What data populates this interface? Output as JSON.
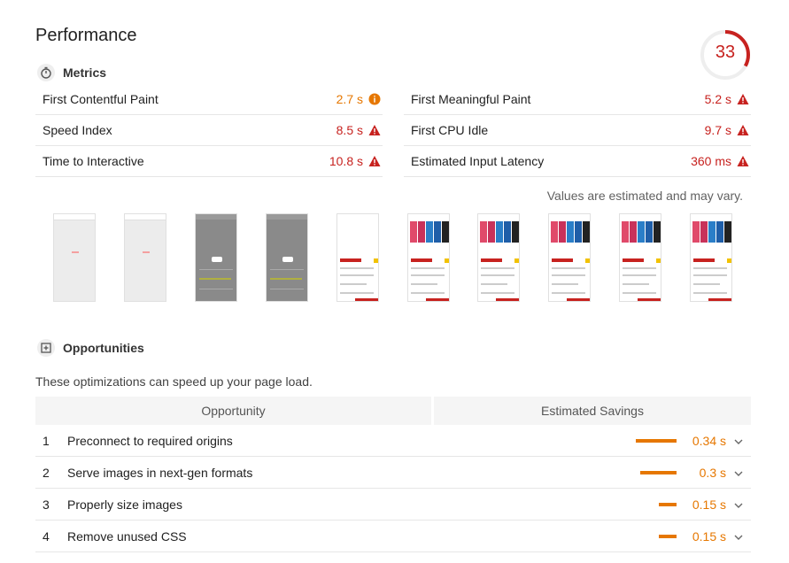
{
  "performance": {
    "title": "Performance",
    "score": "33",
    "score_value": 33,
    "score_color": "#c7221f"
  },
  "metrics": {
    "label": "Metrics",
    "icon": "stopwatch-icon",
    "left": [
      {
        "name": "First Contentful Paint",
        "value": "2.7 s",
        "status": "average",
        "icon": "info-circle-icon"
      },
      {
        "name": "Speed Index",
        "value": "8.5 s",
        "status": "fail",
        "icon": "warning-triangle-icon"
      },
      {
        "name": "Time to Interactive",
        "value": "10.8 s",
        "status": "fail",
        "icon": "warning-triangle-icon"
      }
    ],
    "right": [
      {
        "name": "First Meaningful Paint",
        "value": "5.2 s",
        "status": "fail",
        "icon": "warning-triangle-icon"
      },
      {
        "name": "First CPU Idle",
        "value": "9.7 s",
        "status": "fail",
        "icon": "warning-triangle-icon"
      },
      {
        "name": "Estimated Input Latency",
        "value": "360 ms",
        "status": "fail",
        "icon": "warning-triangle-icon"
      }
    ],
    "note": "Values are estimated and may vary.",
    "colors": {
      "fail": "#c7221f",
      "average": "#e67700"
    }
  },
  "filmstrip": {
    "frames": [
      "blank",
      "blank",
      "gray",
      "gray",
      "listing",
      "phones",
      "phones",
      "phones",
      "phones",
      "phones"
    ]
  },
  "opportunities": {
    "label": "Opportunities",
    "icon": "opportunity-icon",
    "description": "These optimizations can speed up your page load.",
    "col_opportunity": "Opportunity",
    "col_savings": "Estimated Savings",
    "rows": [
      {
        "index": "1",
        "label": "Preconnect to required origins",
        "savings": "0.34 s",
        "savings_value": 0.34
      },
      {
        "index": "2",
        "label": "Serve images in next-gen formats",
        "savings": "0.3 s",
        "savings_value": 0.3
      },
      {
        "index": "3",
        "label": "Properly size images",
        "savings": "0.15 s",
        "savings_value": 0.15
      },
      {
        "index": "4",
        "label": "Remove unused CSS",
        "savings": "0.15 s",
        "savings_value": 0.15
      }
    ],
    "bar_color": "#e67700"
  }
}
